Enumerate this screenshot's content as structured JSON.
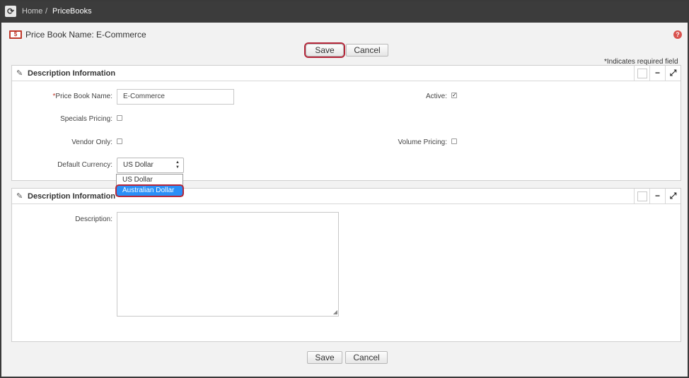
{
  "breadcrumb": {
    "home": "Home",
    "separator": "/",
    "current": "PriceBooks"
  },
  "header": {
    "title_icon": "pricebook-icon",
    "title": "Price Book Name: E-Commerce",
    "help_icon": "help-icon"
  },
  "actions": {
    "save_label": "Save",
    "cancel_label": "Cancel"
  },
  "required_note": "*Indicates required field",
  "panel1": {
    "title": "Description Information",
    "tools": {
      "minimize": "−",
      "expand": "⤢"
    },
    "fields": {
      "price_book_name": {
        "required_mark": "*",
        "label": "Price Book Name:",
        "value": "E-Commerce"
      },
      "active": {
        "label": "Active:",
        "checked": true
      },
      "specials_pricing": {
        "label": "Specials Pricing:",
        "checked": false
      },
      "vendor_only": {
        "label": "Vendor Only:",
        "checked": false
      },
      "volume_pricing": {
        "label": "Volume Pricing:",
        "checked": false
      },
      "default_currency": {
        "label": "Default Currency:",
        "value": "US Dollar",
        "options": [
          "US Dollar",
          "Australian Dollar"
        ],
        "highlighted_option": "Australian Dollar"
      }
    }
  },
  "panel2": {
    "title": "Description Information",
    "tools": {
      "minimize": "−",
      "expand": "⤢"
    },
    "fields": {
      "description": {
        "label": "Description:",
        "value": ""
      }
    }
  },
  "colors": {
    "topbar": "#3c3c3c",
    "required": "#c0392b",
    "highlight_outline": "#b5273a",
    "option_selected": "#2a8ff7"
  }
}
